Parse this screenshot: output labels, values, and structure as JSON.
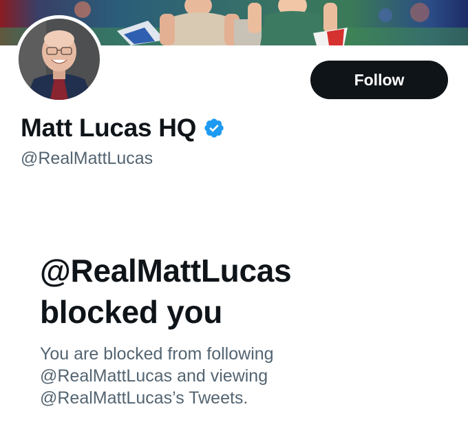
{
  "profile": {
    "display_name": "Matt Lucas HQ",
    "handle": "@RealMattLucas",
    "verified": true,
    "follow_label": "Follow"
  },
  "blocked": {
    "title_line1": "@RealMattLucas",
    "title_line2": "blocked you",
    "desc_line1": "You are blocked from following",
    "desc_line2": "@RealMattLucas and viewing",
    "desc_line3": "@RealMattLucas’s Tweets."
  },
  "colors": {
    "text_primary": "#0f1419",
    "text_secondary": "#536471",
    "verified_blue": "#1d9bf0",
    "button_bg": "#0f1419"
  },
  "icons": {
    "verified": "verified-badge-icon"
  }
}
